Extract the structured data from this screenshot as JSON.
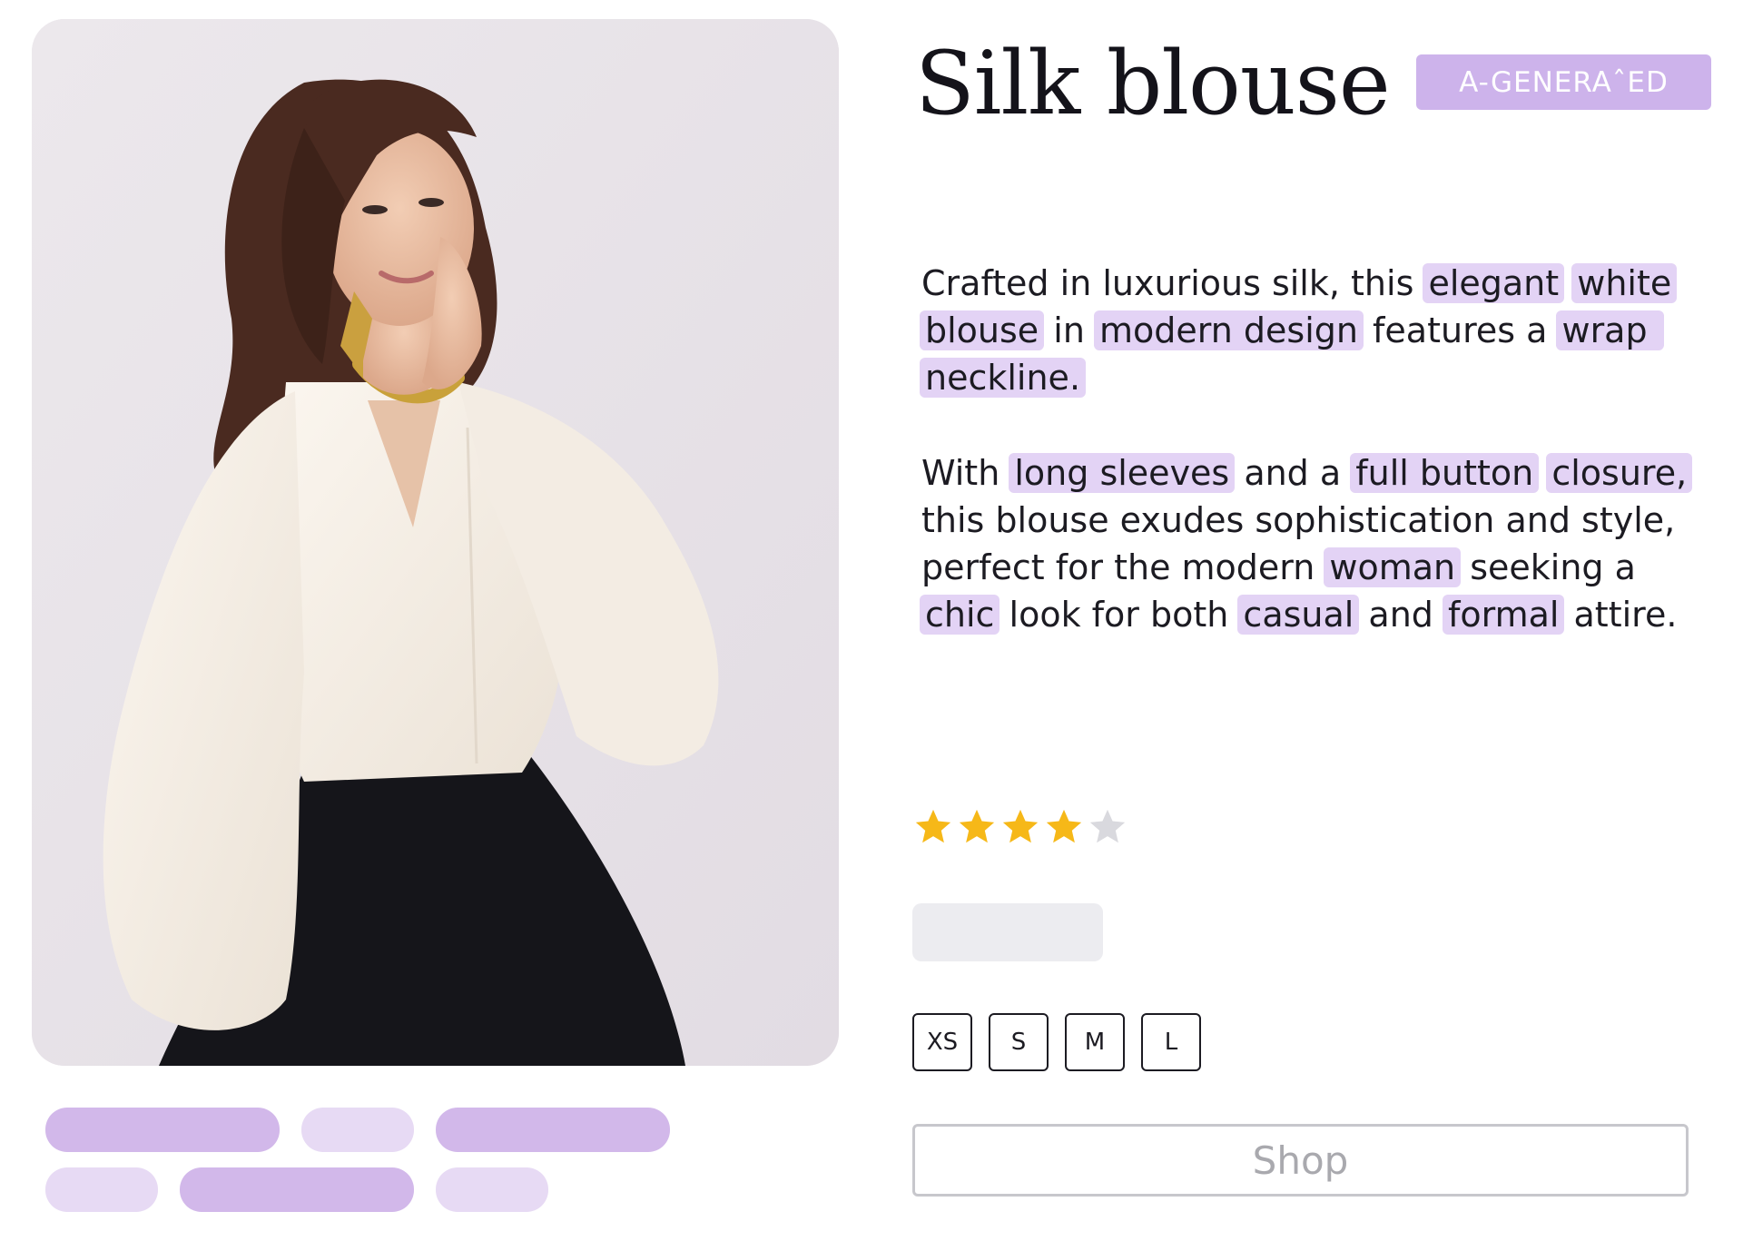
{
  "product": {
    "title": "Silk blouse",
    "badge": "A-GENERAˆED"
  },
  "description": {
    "paragraph1": [
      {
        "text": "Crafted in luxurious silk, this ",
        "highlight": false
      },
      {
        "text": "elegant",
        "highlight": true
      },
      {
        "text": " ",
        "highlight": false
      },
      {
        "text": "white",
        "highlight": true
      },
      {
        "text": " ",
        "highlight": false
      },
      {
        "text": "blouse",
        "highlight": true
      },
      {
        "text": " in ",
        "highlight": false
      },
      {
        "text": "modern design",
        "highlight": true
      },
      {
        "text": " features a ",
        "highlight": false
      },
      {
        "text": "wrap neckline.",
        "highlight": true
      }
    ],
    "paragraph2": [
      {
        "text": "With ",
        "highlight": false
      },
      {
        "text": "long sleeves",
        "highlight": true
      },
      {
        "text": " and a ",
        "highlight": false
      },
      {
        "text": "full button",
        "highlight": true
      },
      {
        "text": " ",
        "highlight": false
      },
      {
        "text": "closure,",
        "highlight": true
      },
      {
        "text": " this blouse exudes sophistication and style, perfect for the modern ",
        "highlight": false
      },
      {
        "text": "woman",
        "highlight": true
      },
      {
        "text": " seeking a ",
        "highlight": false
      },
      {
        "text": "chic",
        "highlight": true
      },
      {
        "text": " look for both ",
        "highlight": false
      },
      {
        "text": "casual",
        "highlight": true
      },
      {
        "text": " and ",
        "highlight": false
      },
      {
        "text": "formal",
        "highlight": true
      },
      {
        "text": " attire.",
        "highlight": false
      }
    ]
  },
  "rating": {
    "value": 4,
    "max": 5
  },
  "sizes": [
    "XS",
    "S",
    "M",
    "L"
  ],
  "shop_button": "Shop",
  "tags": {
    "row1": [
      {
        "shade": "dark"
      },
      {
        "shade": "light"
      },
      {
        "shade": "dark"
      }
    ],
    "row2": [
      {
        "shade": "light"
      },
      {
        "shade": "dark"
      },
      {
        "shade": "light"
      }
    ]
  },
  "colors": {
    "accent": "#cdb3eb",
    "highlight": "#e3d3f5",
    "star_filled": "#f6b818",
    "star_empty": "#d9d9de"
  },
  "icons": {
    "star": "star-icon"
  }
}
